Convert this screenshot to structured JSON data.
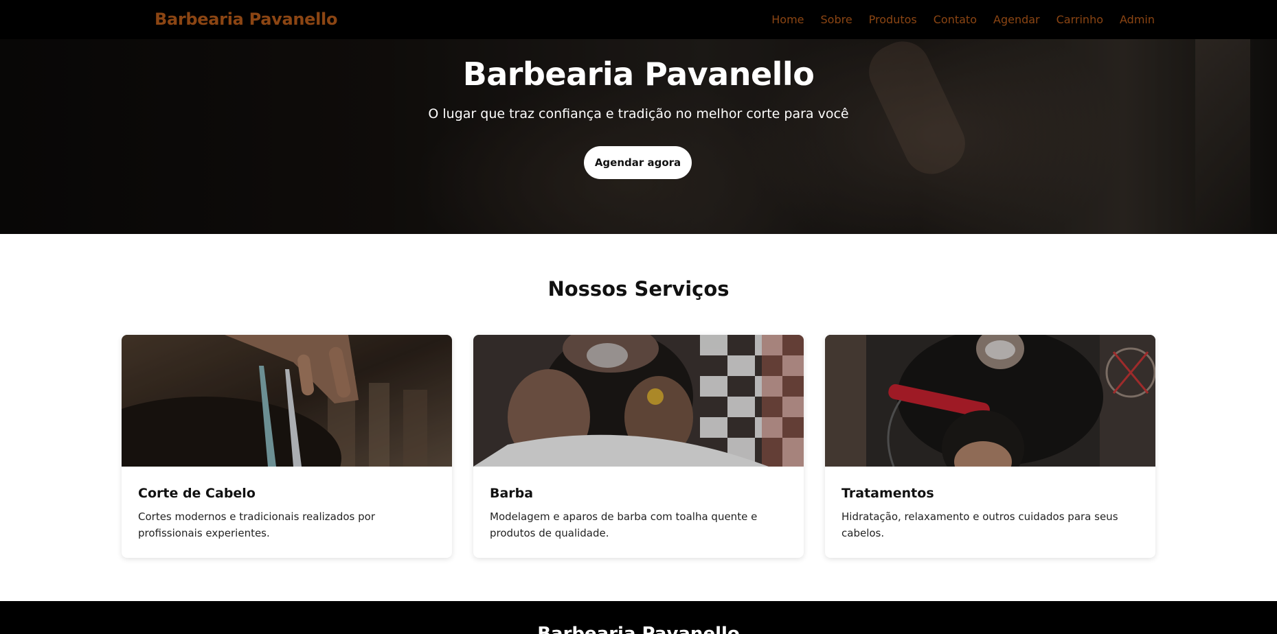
{
  "navbar": {
    "brand": "Barbearia Pavanello",
    "links": [
      "Home",
      "Sobre",
      "Produtos",
      "Contato",
      "Agendar",
      "Carrinho",
      "Admin"
    ]
  },
  "hero": {
    "title": "Barbearia Pavanello",
    "subtitle": "O lugar que traz confiança e tradição no melhor corte para você",
    "button_label": "Agendar agora"
  },
  "services": {
    "title": "Nossos Serviços",
    "cards": [
      {
        "title": "Corte de Cabelo",
        "text": "Cortes modernos e tradicionais realizados por profissionais experientes."
      },
      {
        "title": "Barba",
        "text": "Modelagem e aparos de barba com toalha quente e produtos de qualidade."
      },
      {
        "title": "Tratamentos",
        "text": "Hidratação, relaxamento e outros cuidados para seus cabelos."
      }
    ]
  },
  "footer": {
    "title": "Barbearia Pavanello"
  },
  "colors": {
    "nav_background": "#000000",
    "brand_accent": "#8b4513",
    "hero_text": "#ffffff",
    "footer_background": "#000000"
  }
}
